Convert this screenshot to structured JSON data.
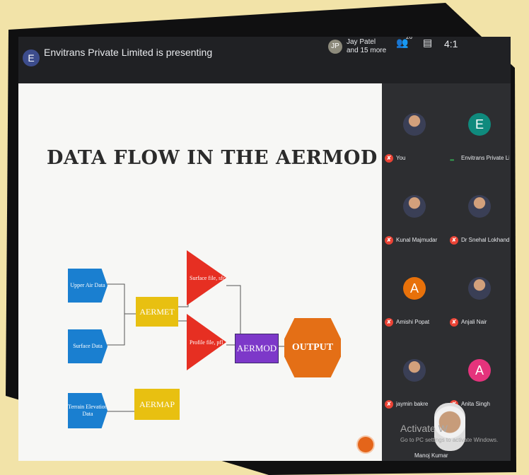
{
  "meeting": {
    "presenter_initial": "E",
    "presenter_text": "Envitrans Private Limited is presenting",
    "viewer_initial": "JP",
    "viewer_name": "Jay Patel",
    "viewer_more": "and 15 more",
    "people_count": "26",
    "clock": "4:1"
  },
  "slide": {
    "title": "DATA FLOW IN THE AERMOD",
    "inputs": [
      "Upper Air Data",
      "Surface Data",
      "Terrain Elevation Data"
    ],
    "processors": [
      "AERMET",
      "AERMAP"
    ],
    "files": [
      "Surface file, sfc",
      "Profile file, pfl"
    ],
    "model": "AERMOD",
    "output": "OUTPUT"
  },
  "participants": [
    {
      "name": "You",
      "initial": "",
      "color": "#6b5a7c",
      "muted": true,
      "photo": true
    },
    {
      "name": "Envitrans Private Li...",
      "initial": "E",
      "color": "#0f8a7d",
      "muted": false,
      "photo": false
    },
    {
      "name": "Kunal Majmudar",
      "initial": "",
      "color": "#3a4a7a",
      "muted": true,
      "photo": true
    },
    {
      "name": "Dr Snehal Lokhand...",
      "initial": "",
      "color": "#4a3a3a",
      "muted": true,
      "photo": true
    },
    {
      "name": "Amishi Popat",
      "initial": "A",
      "color": "#e8710a",
      "muted": true,
      "photo": false
    },
    {
      "name": "Anjali Nair",
      "initial": "",
      "color": "#c9411c",
      "muted": true,
      "photo": true
    },
    {
      "name": "jaymin bakre",
      "initial": "",
      "color": "#5a6a4a",
      "muted": true,
      "photo": true
    },
    {
      "name": "Anita Singh",
      "initial": "A",
      "color": "#e5337c",
      "muted": true,
      "photo": false
    }
  ],
  "overlay": {
    "activate_title": "Activate W",
    "activate_sub": "Go to PC settings to activate Windows.",
    "self_name": "Manoj Kumar"
  }
}
